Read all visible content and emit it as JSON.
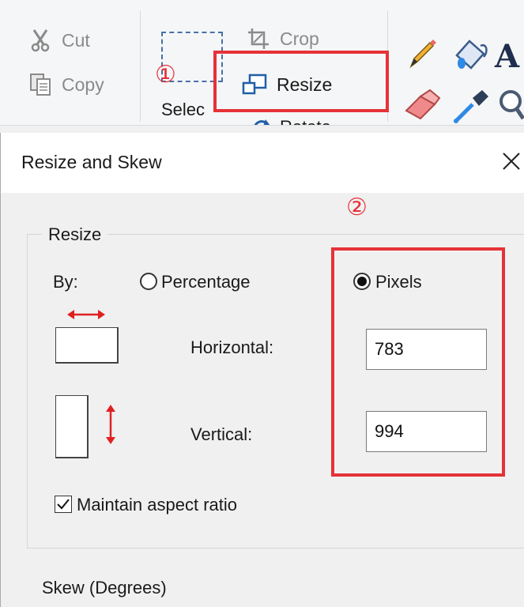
{
  "ribbon": {
    "cut_label": "Cut",
    "copy_label": "Copy",
    "crop_label": "Crop",
    "resize_label": "Resize",
    "rotate_label": "Rotate",
    "select_label": "Selec",
    "text_tool_glyph": "A",
    "callout_1": "①"
  },
  "dialog": {
    "title": "Resize and Skew",
    "callout_2": "②",
    "resize_group_label": "Resize",
    "by_label": "By:",
    "percentage_label": "Percentage",
    "pixels_label": "Pixels",
    "selected_unit": "Pixels",
    "horizontal_label": "Horizontal:",
    "vertical_label": "Vertical:",
    "horizontal_value": "783",
    "vertical_value": "994",
    "maintain_aspect_label": "Maintain aspect ratio",
    "maintain_aspect_checked": true,
    "skew_group_label": "Skew (Degrees)"
  },
  "colors": {
    "callout": "#e53238",
    "arrow": "#e02020"
  },
  "icons": [
    "scissors-icon",
    "copy-icon",
    "crop-icon",
    "resize-icon",
    "rotate-icon",
    "pencil-icon",
    "fill-icon",
    "text-icon",
    "eraser-icon",
    "color-picker-icon",
    "magnifier-icon",
    "close-icon",
    "horizontal-arrow-icon",
    "vertical-arrow-icon",
    "checkmark-icon"
  ]
}
